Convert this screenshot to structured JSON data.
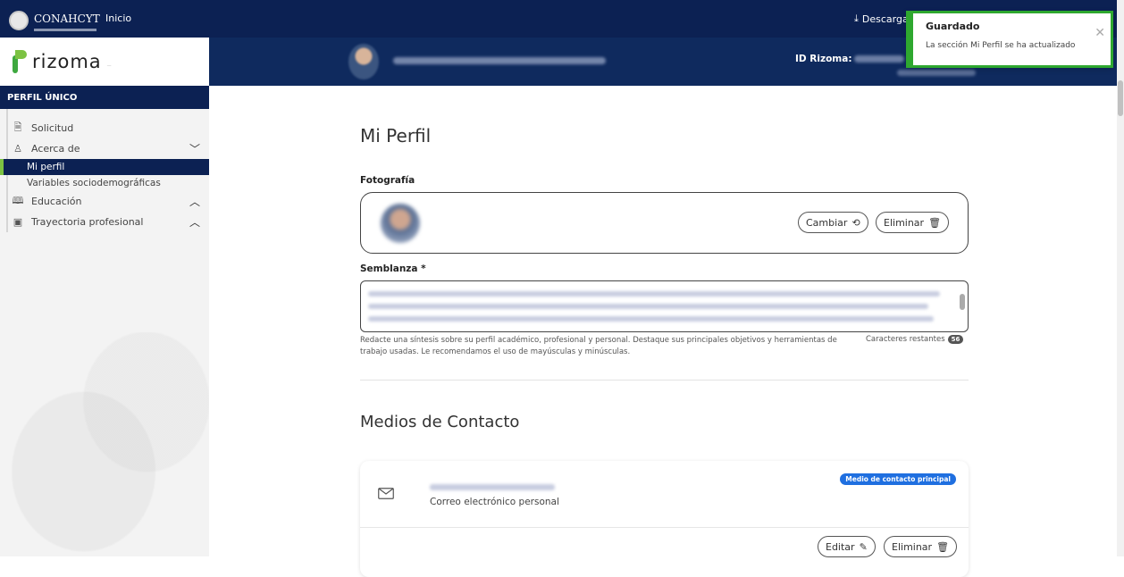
{
  "topbar": {
    "gov_name": "CONAHCYT",
    "home_label": "Inicio",
    "download_label": "Descarga"
  },
  "sidebar": {
    "brand_name": "rizoma",
    "section_title": "PERFIL ÚNICO",
    "items": [
      {
        "label": "Solicitud",
        "icon": "document-icon"
      },
      {
        "label": "Acerca de",
        "icon": "user-icon",
        "expanded": true,
        "children": [
          {
            "label": "Mi perfil",
            "active": true
          },
          {
            "label": "Variables sociodemográficas"
          }
        ]
      },
      {
        "label": "Educación",
        "icon": "book-icon"
      },
      {
        "label": "Trayectoria profesional",
        "icon": "badge-icon"
      }
    ]
  },
  "banner": {
    "id_label": "ID Rizoma:"
  },
  "toast": {
    "title": "Guardado",
    "message": "La sección Mi Perfil se ha actualizado"
  },
  "main": {
    "title": "Mi Perfil",
    "photo_label": "Fotografía",
    "change_label": "Cambiar",
    "delete_label": "Eliminar",
    "bio_label": "Semblanza *",
    "bio_helper": "Redacte una síntesis sobre su perfil académico, profesional y personal. Destaque sus principales objetivos y herramientas de trabajo usadas. Le recomendamos el uso de mayúsculas y minúsculas.",
    "chars_label": "Caracteres restantes",
    "chars_remaining": "56",
    "contact_title": "Medios de Contacto",
    "contact": {
      "type": "Correo electrónico personal",
      "primary_badge": "Medio de contacto principal",
      "edit_label": "Editar",
      "delete_label": "Eliminar"
    }
  },
  "colors": {
    "navy": "#0c2153",
    "accent_green": "#7cc242",
    "toast_border": "#2ea82f",
    "badge_blue": "#1f6fe0"
  }
}
